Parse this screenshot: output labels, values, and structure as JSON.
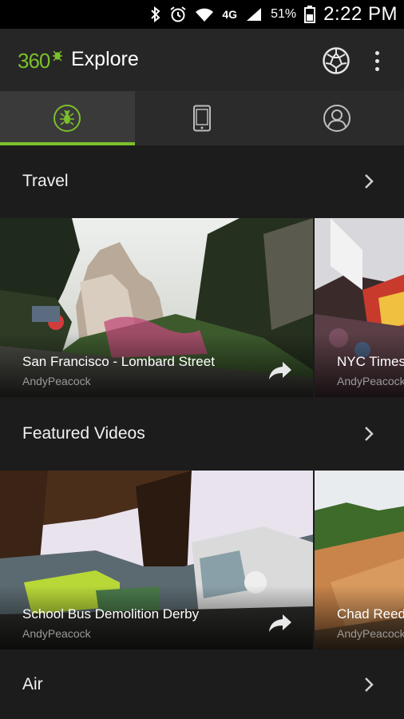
{
  "status_bar": {
    "bluetooth_icon": "bluetooth-icon",
    "alarm_icon": "alarm-icon",
    "wifi_icon": "wifi-icon",
    "network": "4G",
    "signal_icon": "signal-icon",
    "battery": "51%",
    "time": "2:22 PM"
  },
  "app_bar": {
    "logo_text": "360",
    "title": "Explore",
    "globe_icon": "globe-icon",
    "overflow_icon": "overflow-menu-icon"
  },
  "tabs": [
    {
      "icon": "bug-logo-icon",
      "active": true
    },
    {
      "icon": "phone-icon",
      "active": false
    },
    {
      "icon": "profile-icon",
      "active": false
    }
  ],
  "sections": [
    {
      "title": "Travel",
      "cards": [
        {
          "title": "San Francisco - Lombard Street",
          "author": "AndyPeacock"
        },
        {
          "title": "NYC Times",
          "author": "AndyPeacock"
        }
      ]
    },
    {
      "title": "Featured Videos",
      "cards": [
        {
          "title": "School Bus Demolition Derby",
          "author": "AndyPeacock"
        },
        {
          "title": "Chad Reed",
          "author": "AndyPeacock"
        }
      ]
    },
    {
      "title": "Air",
      "cards": []
    }
  ],
  "colors": {
    "accent": "#7bbf2a",
    "background": "#1c1c1c",
    "app_bar": "#262626"
  }
}
